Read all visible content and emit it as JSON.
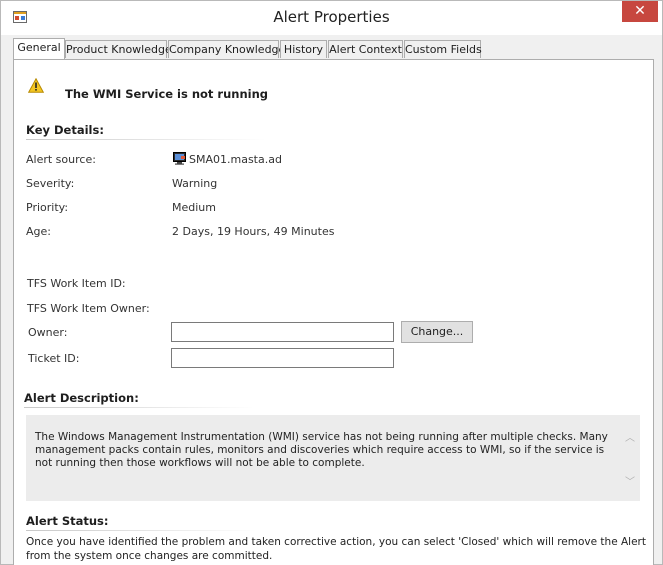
{
  "window": {
    "title": "Alert Properties",
    "close_glyph": "✕"
  },
  "tabs": [
    {
      "label": "General",
      "active": true
    },
    {
      "label": "Product Knowledge"
    },
    {
      "label": "Company Knowledge"
    },
    {
      "label": "History"
    },
    {
      "label": "Alert Context"
    },
    {
      "label": "Custom Fields"
    }
  ],
  "alert": {
    "title": "The WMI Service is not running",
    "icon": "warning-icon"
  },
  "key_details": {
    "heading": "Key Details:",
    "alert_source_label": "Alert source:",
    "alert_source_value": "SMA01.masta.ad",
    "severity_label": "Severity:",
    "severity_value": "Warning",
    "priority_label": "Priority:",
    "priority_value": "Medium",
    "age_label": "Age:",
    "age_value": "2 Days, 19 Hours, 49 Minutes",
    "tfs_item_label": "TFS Work Item ID:",
    "tfs_owner_label": "TFS Work Item Owner:",
    "owner_label": "Owner:",
    "owner_value": "",
    "change_button": "Change...",
    "ticket_label": "Ticket ID:",
    "ticket_value": ""
  },
  "description": {
    "heading": "Alert Description:",
    "text": "The Windows Management Instrumentation (WMI) service has not being running after multiple checks. Many management packs contain rules, monitors and discoveries which require access to WMI, so if the service is not running then those workflows will not be able to complete."
  },
  "status": {
    "heading": "Alert Status:",
    "text": "Once you have identified the problem and taken corrective action, you can select 'Closed' which will remove the Alert from the system once changes are committed."
  },
  "colors": {
    "close_button": "#c7473f",
    "description_bg": "#ececec"
  }
}
